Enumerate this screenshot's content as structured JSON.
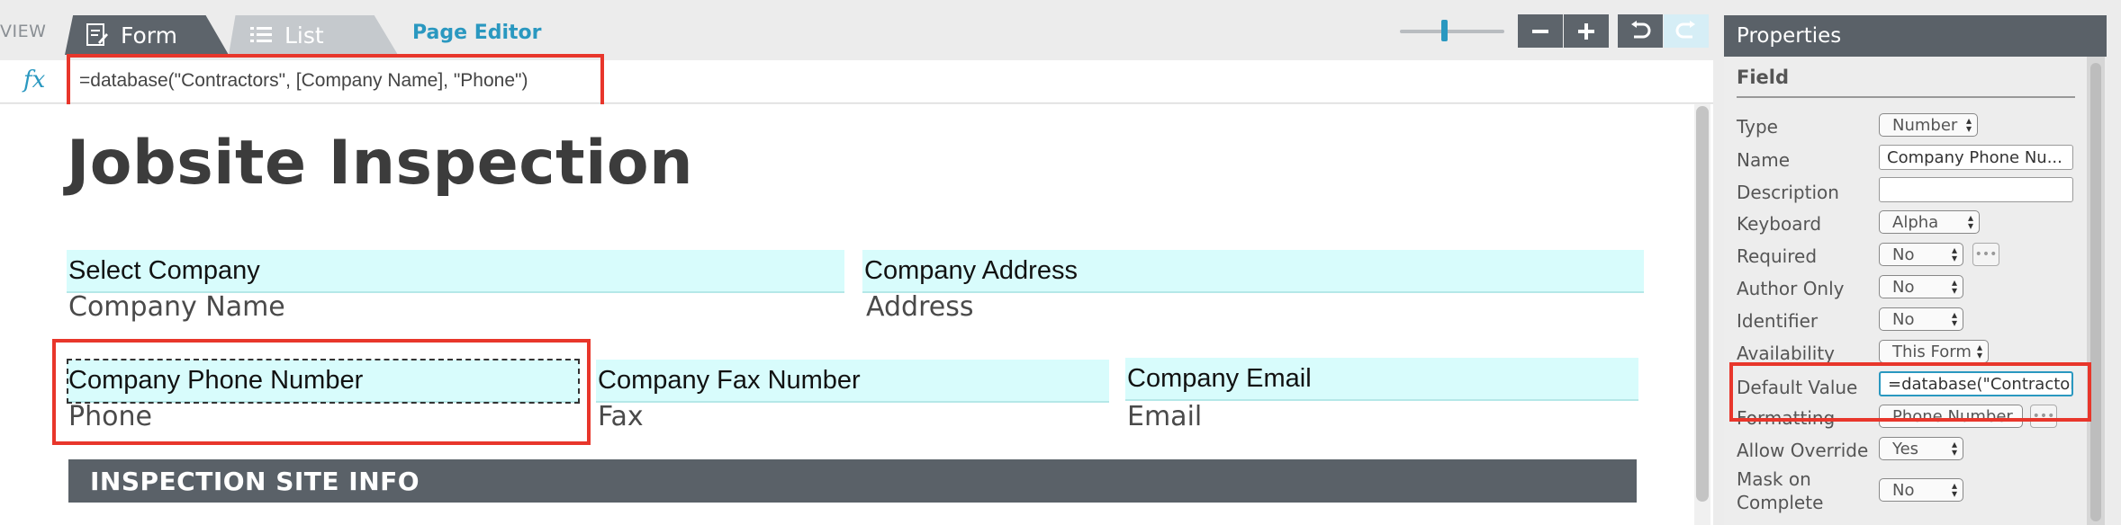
{
  "toolbar": {
    "view_label": "VIEW",
    "tab_form": "Form",
    "tab_list": "List",
    "page_editor": "Page Editor"
  },
  "formula": {
    "fx": "fx",
    "value": "=database(\"Contractors\", [Company Name], \"Phone\")"
  },
  "form": {
    "title": "Jobsite Inspection",
    "fields": [
      {
        "label": "Select Company",
        "name": "Company Name"
      },
      {
        "label": "Company Address",
        "name": "Address"
      },
      {
        "label": "Company Phone Number",
        "name": "Phone"
      },
      {
        "label": "Company Fax Number",
        "name": "Fax"
      },
      {
        "label": "Company Email",
        "name": "Email"
      }
    ],
    "section": "INSPECTION SITE INFO"
  },
  "properties": {
    "header": "Properties",
    "group": "Field",
    "rows": [
      {
        "label": "Type",
        "value": "Number"
      },
      {
        "label": "Name",
        "value": "Company Phone Nu..."
      },
      {
        "label": "Description",
        "value": ""
      },
      {
        "label": "Keyboard",
        "value": "Alpha"
      },
      {
        "label": "Required",
        "value": "No"
      },
      {
        "label": "Author Only",
        "value": "No"
      },
      {
        "label": "Identifier",
        "value": "No"
      },
      {
        "label": "Availability",
        "value": "This Form"
      },
      {
        "label": "Default Value",
        "value": "=database(\"Contractors"
      },
      {
        "label": "Formatting",
        "value": "Phone Number"
      },
      {
        "label": "Allow Override",
        "value": "Yes"
      },
      {
        "label": "Mask on Complete",
        "value": "No"
      }
    ]
  },
  "colors": {
    "accent": "#2a98c0",
    "highlight_red": "#e8362b",
    "field_label_bg": "#d8fcfc",
    "dark_gray": "#5a6168"
  }
}
